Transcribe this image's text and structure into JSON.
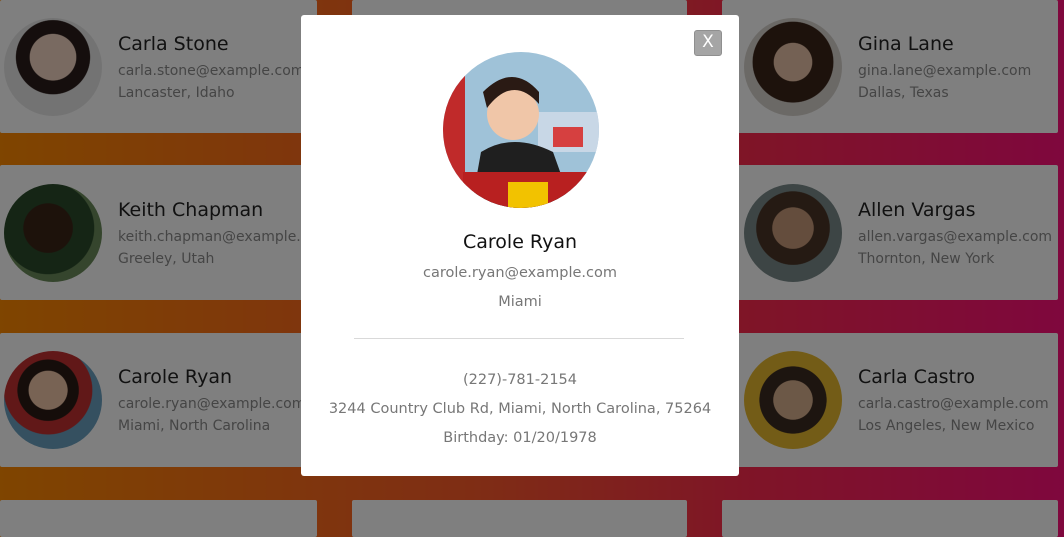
{
  "cards": [
    {
      "name": "Carla Stone",
      "email": "carla.stone@example.com",
      "location": "Lancaster, Idaho"
    },
    {
      "name": "Gina Lane",
      "email": "gina.lane@example.com",
      "location": "Dallas, Texas"
    },
    {
      "name": "Keith Chapman",
      "email": "keith.chapman@example.com",
      "location": "Greeley, Utah"
    },
    {
      "name": "Allen Vargas",
      "email": "allen.vargas@example.com",
      "location": "Thornton, New York"
    },
    {
      "name": "Carole Ryan",
      "email": "carole.ryan@example.com",
      "location": "Miami, North Carolina"
    },
    {
      "name": "Carla Castro",
      "email": "carla.castro@example.com",
      "location": "Los Angeles, New Mexico"
    }
  ],
  "modal": {
    "close_label": "X",
    "name": "Carole Ryan",
    "email": "carole.ryan@example.com",
    "city": "Miami",
    "phone": "(227)-781-2154",
    "address": "3244 Country Club Rd, Miami, North Carolina, 75264",
    "birthday": "Birthday: 01/20/1978"
  },
  "colors": {
    "gradient_start": "#ff8a00",
    "gradient_end": "#ff0f7b",
    "overlay": "rgba(0,0,0,0.5)",
    "close_button": "#a5a5a5"
  }
}
